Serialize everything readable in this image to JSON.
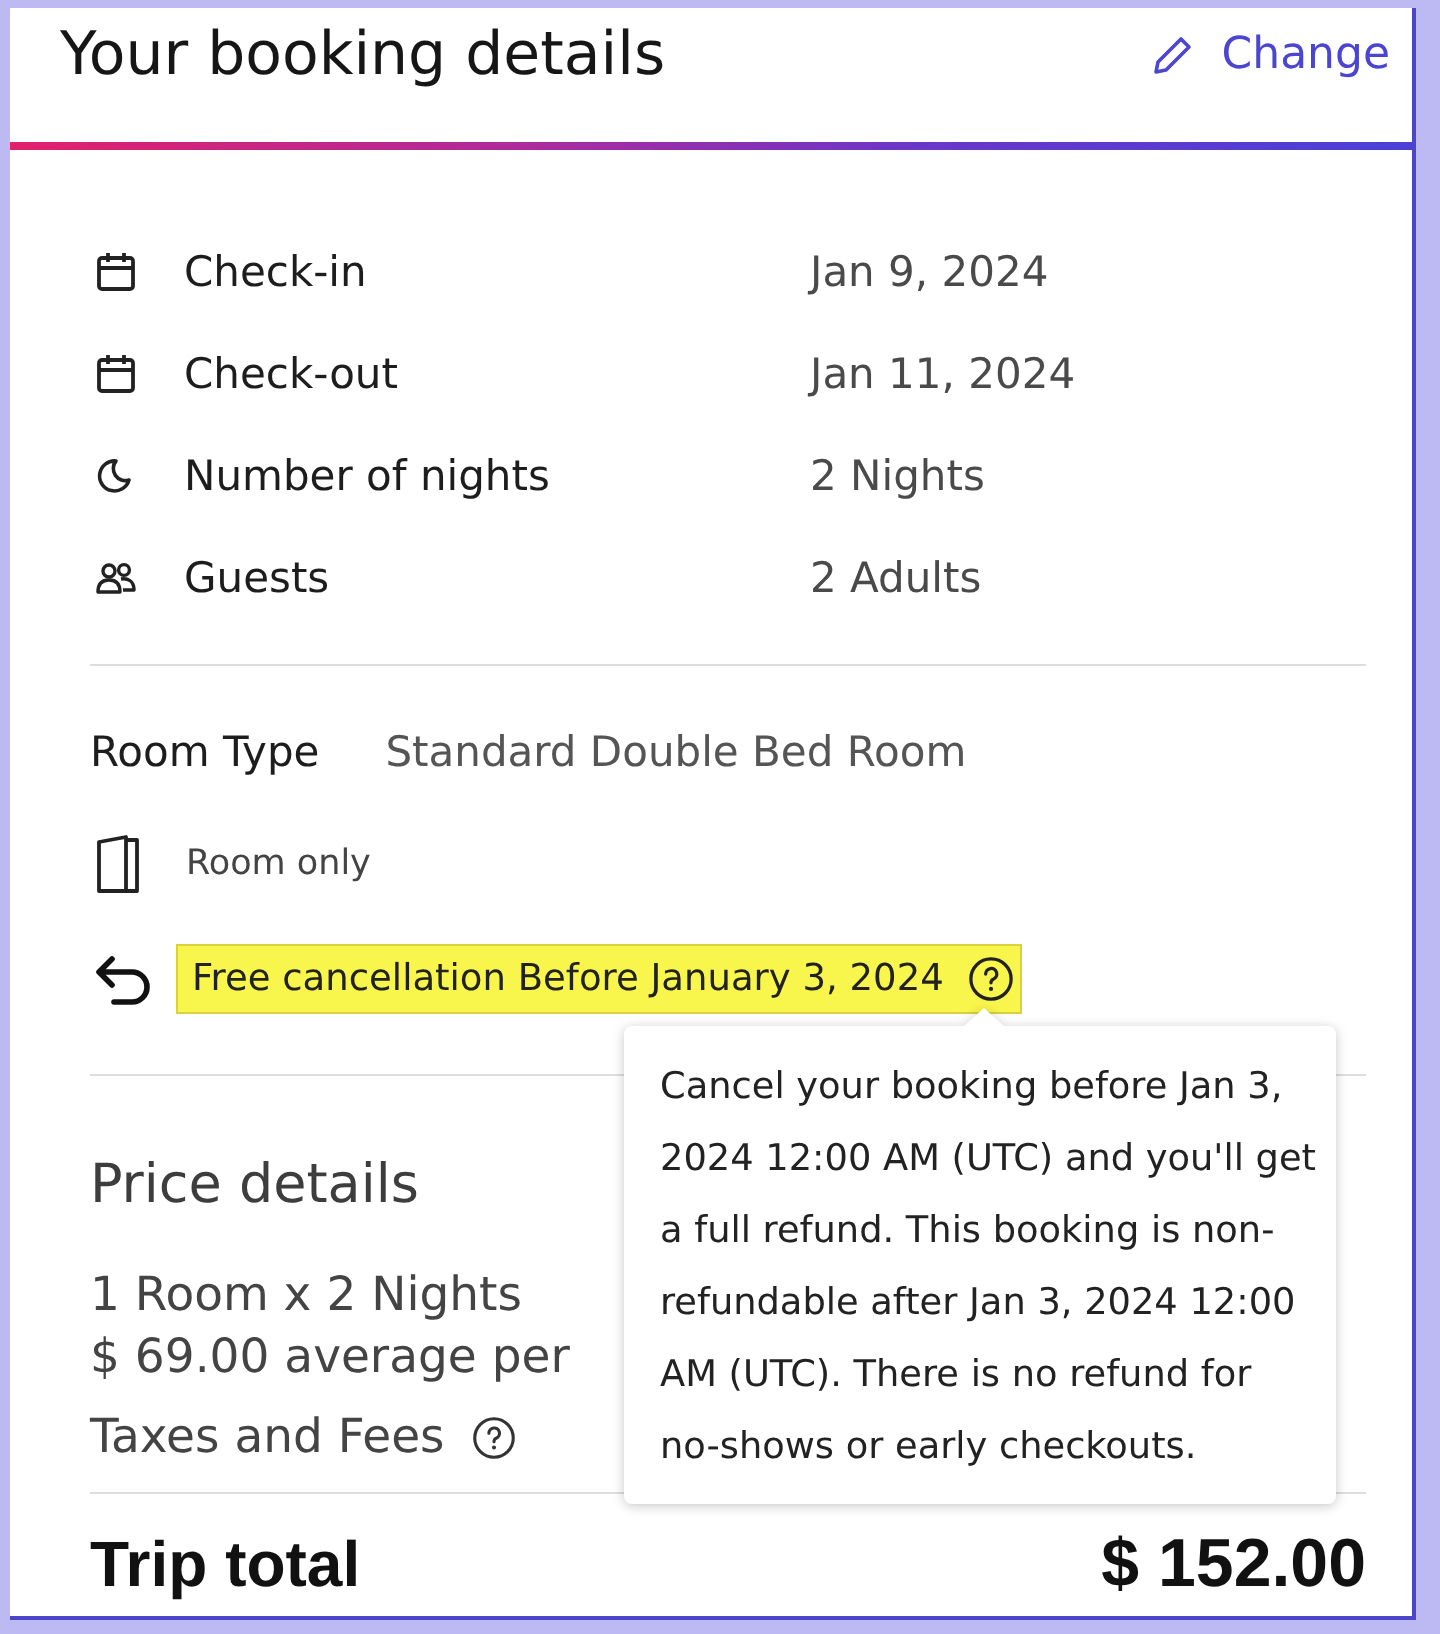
{
  "header": {
    "title": "Your booking details",
    "action": "Change"
  },
  "details": [
    {
      "kind": "calendar",
      "label": "Check-in",
      "value": "Jan 9, 2024"
    },
    {
      "kind": "calendar",
      "label": "Check-out",
      "value": "Jan 11, 2024"
    },
    {
      "kind": "moon",
      "label": "Number of nights",
      "value": "2 Nights"
    },
    {
      "kind": "guests",
      "label": "Guests",
      "value": "2 Adults"
    }
  ],
  "room": {
    "label": "Room Type",
    "value": "Standard Double Bed Room",
    "board": "Room only",
    "cancellation": {
      "text": "Free cancellation Before January 3, 2024",
      "highlighted": true
    }
  },
  "tooltip": {
    "text": "Cancel your booking before Jan 3, 2024 12:00 AM (UTC) and you'll get a full refund. This booking is non-refundable after Jan 3, 2024 12:00 AM (UTC). There is no refund for no-shows or early checkouts."
  },
  "price": {
    "title": "Price details",
    "lines": [
      {
        "label": "1 Room x 2 Nights",
        "note": "$ 69.00 average per",
        "info": false
      },
      {
        "label": "Taxes and Fees",
        "info": true
      }
    ]
  },
  "total": {
    "label": "Trip total",
    "amount": "$ 152.00"
  }
}
